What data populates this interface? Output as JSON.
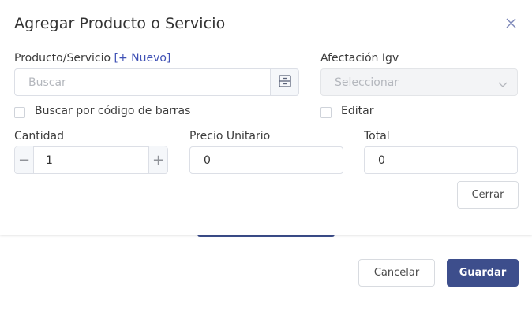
{
  "dialog": {
    "title": "Agregar Producto o Servicio",
    "close_icon": "close-icon"
  },
  "product": {
    "label": "Producto/Servicio",
    "new_link": "[+ Nuevo]",
    "placeholder": "Buscar",
    "search_icon": "cabinet-icon"
  },
  "igv": {
    "label": "Afectación Igv",
    "placeholder": "Seleccionar"
  },
  "barcode": {
    "label": "Buscar por código de barras"
  },
  "edit": {
    "label": "Editar"
  },
  "quantity": {
    "label": "Cantidad",
    "value": "1",
    "minus": "−",
    "plus": "+"
  },
  "unit_price": {
    "label": "Precio Unitario",
    "value": "0"
  },
  "total": {
    "label": "Total",
    "value": "0"
  },
  "buttons": {
    "close": "Cerrar",
    "cancel": "Cancelar",
    "save": "Guardar"
  },
  "colors": {
    "primary": "#3d4e8c",
    "link": "#3f51b5",
    "border": "#dcdfe6"
  }
}
